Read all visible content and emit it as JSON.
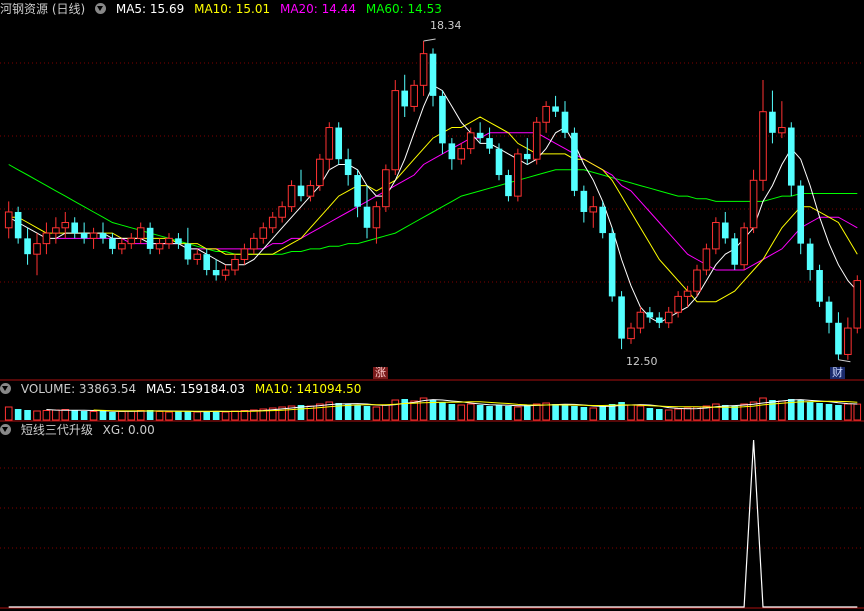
{
  "header": {
    "title": "河钢资源 (日线)",
    "ma5": {
      "label": "MA5: 15.69",
      "color": "#ffffff"
    },
    "ma10": {
      "label": "MA10: 15.01",
      "color": "#ffff00"
    },
    "ma20": {
      "label": "MA20: 14.44",
      "color": "#ff00ff"
    },
    "ma60": {
      "label": "MA60: 14.53",
      "color": "#00ff00"
    }
  },
  "volume_header": {
    "volume": "VOLUME: 33863.54",
    "ma5": "MA5: 159184.03",
    "ma10": "MA10: 141094.50"
  },
  "indicator_header": {
    "name": "短线三代升级",
    "xg": "XG: 0.00"
  },
  "annotations": {
    "high": "18.34",
    "low": "12.50",
    "tag_zhang": "涨",
    "tag_cai": "财"
  },
  "colors": {
    "up": "#ff3232",
    "down": "#54ffff",
    "grid": "#800000",
    "xg": "#ffffff"
  },
  "chart_data": [
    {
      "type": "candlestick",
      "title": "河钢资源 (日线)",
      "ylim": [
        12.2,
        18.7
      ],
      "candles": [
        [
          14.8,
          15.3,
          14.6,
          15.1
        ],
        [
          15.1,
          15.2,
          14.5,
          14.6
        ],
        [
          14.6,
          14.8,
          14.1,
          14.3
        ],
        [
          14.3,
          14.7,
          13.9,
          14.5
        ],
        [
          14.5,
          14.9,
          14.3,
          14.7
        ],
        [
          14.7,
          15.0,
          14.5,
          14.8
        ],
        [
          14.8,
          15.1,
          14.6,
          14.9
        ],
        [
          14.9,
          15.0,
          14.6,
          14.7
        ],
        [
          14.7,
          14.9,
          14.5,
          14.6
        ],
        [
          14.6,
          14.8,
          14.4,
          14.7
        ],
        [
          14.7,
          14.9,
          14.5,
          14.6
        ],
        [
          14.6,
          14.7,
          14.3,
          14.4
        ],
        [
          14.4,
          14.6,
          14.3,
          14.5
        ],
        [
          14.5,
          14.7,
          14.4,
          14.6
        ],
        [
          14.6,
          14.9,
          14.5,
          14.8
        ],
        [
          14.8,
          14.9,
          14.3,
          14.4
        ],
        [
          14.4,
          14.6,
          14.3,
          14.5
        ],
        [
          14.5,
          14.7,
          14.4,
          14.6
        ],
        [
          14.6,
          14.7,
          14.4,
          14.5
        ],
        [
          14.5,
          14.8,
          14.1,
          14.2
        ],
        [
          14.2,
          14.4,
          14.1,
          14.3
        ],
        [
          14.3,
          14.4,
          13.9,
          14.0
        ],
        [
          14.0,
          14.2,
          13.8,
          13.9
        ],
        [
          13.9,
          14.1,
          13.8,
          14.0
        ],
        [
          14.0,
          14.3,
          13.9,
          14.2
        ],
        [
          14.2,
          14.5,
          14.1,
          14.4
        ],
        [
          14.4,
          14.7,
          14.3,
          14.6
        ],
        [
          14.6,
          14.9,
          14.5,
          14.8
        ],
        [
          14.8,
          15.1,
          14.7,
          15.0
        ],
        [
          15.0,
          15.3,
          14.9,
          15.2
        ],
        [
          15.2,
          15.7,
          15.1,
          15.6
        ],
        [
          15.6,
          15.9,
          15.3,
          15.4
        ],
        [
          15.4,
          15.7,
          15.3,
          15.6
        ],
        [
          15.6,
          16.2,
          15.5,
          16.1
        ],
        [
          16.1,
          16.8,
          15.9,
          16.7
        ],
        [
          16.7,
          16.8,
          16.0,
          16.1
        ],
        [
          16.1,
          16.3,
          15.6,
          15.8
        ],
        [
          15.8,
          15.9,
          15.0,
          15.2
        ],
        [
          15.2,
          15.6,
          14.6,
          14.8
        ],
        [
          14.8,
          15.3,
          14.5,
          15.2
        ],
        [
          15.2,
          16.0,
          15.1,
          15.9
        ],
        [
          15.9,
          17.6,
          15.8,
          17.4
        ],
        [
          17.4,
          17.7,
          16.9,
          17.1
        ],
        [
          17.1,
          17.6,
          17.0,
          17.5
        ],
        [
          17.5,
          18.34,
          17.3,
          18.1
        ],
        [
          18.1,
          18.2,
          17.1,
          17.3
        ],
        [
          17.3,
          17.4,
          16.2,
          16.4
        ],
        [
          16.4,
          16.5,
          15.9,
          16.1
        ],
        [
          16.1,
          16.4,
          16.0,
          16.3
        ],
        [
          16.3,
          16.7,
          16.2,
          16.6
        ],
        [
          16.6,
          16.8,
          16.4,
          16.5
        ],
        [
          16.5,
          16.7,
          16.2,
          16.3
        ],
        [
          16.3,
          16.4,
          15.7,
          15.8
        ],
        [
          15.8,
          15.9,
          15.3,
          15.4
        ],
        [
          15.4,
          16.3,
          15.3,
          16.2
        ],
        [
          16.2,
          16.5,
          16.0,
          16.1
        ],
        [
          16.1,
          16.9,
          16.0,
          16.8
        ],
        [
          16.8,
          17.2,
          16.6,
          17.1
        ],
        [
          17.1,
          17.3,
          16.9,
          17.0
        ],
        [
          17.0,
          17.2,
          16.5,
          16.6
        ],
        [
          16.6,
          16.7,
          15.4,
          15.5
        ],
        [
          15.5,
          15.6,
          14.9,
          15.1
        ],
        [
          15.1,
          15.4,
          14.8,
          15.2
        ],
        [
          15.2,
          15.3,
          14.6,
          14.7
        ],
        [
          14.7,
          14.8,
          13.4,
          13.5
        ],
        [
          13.5,
          13.6,
          12.5,
          12.7
        ],
        [
          12.7,
          13.0,
          12.6,
          12.9
        ],
        [
          12.9,
          13.3,
          12.8,
          13.2
        ],
        [
          13.2,
          13.3,
          13.0,
          13.1
        ],
        [
          13.1,
          13.2,
          12.9,
          13.0
        ],
        [
          13.0,
          13.3,
          12.9,
          13.2
        ],
        [
          13.2,
          13.6,
          13.1,
          13.5
        ],
        [
          13.5,
          13.7,
          13.3,
          13.6
        ],
        [
          13.6,
          14.1,
          13.5,
          14.0
        ],
        [
          14.0,
          14.5,
          13.9,
          14.4
        ],
        [
          14.4,
          15.0,
          14.3,
          14.9
        ],
        [
          14.9,
          15.1,
          14.5,
          14.6
        ],
        [
          14.6,
          14.7,
          14.0,
          14.1
        ],
        [
          14.1,
          14.9,
          14.0,
          14.8
        ],
        [
          14.8,
          15.9,
          14.7,
          15.7
        ],
        [
          15.7,
          17.6,
          15.5,
          17.0
        ],
        [
          17.0,
          17.4,
          16.4,
          16.6
        ],
        [
          16.6,
          17.2,
          16.5,
          16.7
        ],
        [
          16.7,
          16.8,
          15.4,
          15.6
        ],
        [
          15.6,
          15.7,
          14.3,
          14.5
        ],
        [
          14.5,
          14.6,
          13.8,
          14.0
        ],
        [
          14.0,
          14.1,
          13.3,
          13.4
        ],
        [
          13.4,
          13.5,
          12.8,
          13.0
        ],
        [
          13.0,
          13.2,
          12.3,
          12.4
        ],
        [
          12.4,
          13.1,
          12.3,
          12.9
        ],
        [
          12.9,
          13.9,
          12.8,
          13.8
        ]
      ],
      "ma5": [
        15.0,
        14.9,
        14.8,
        14.7,
        14.6,
        14.6,
        14.7,
        14.7,
        14.7,
        14.7,
        14.7,
        14.6,
        14.6,
        14.6,
        14.6,
        14.5,
        14.5,
        14.5,
        14.5,
        14.4,
        14.4,
        14.3,
        14.2,
        14.1,
        14.1,
        14.1,
        14.2,
        14.4,
        14.6,
        14.8,
        15.0,
        15.2,
        15.4,
        15.6,
        15.9,
        16.0,
        16.0,
        15.9,
        15.6,
        15.4,
        15.4,
        15.7,
        16.1,
        16.6,
        17.1,
        17.5,
        17.4,
        17.1,
        16.8,
        16.6,
        16.4,
        16.4,
        16.3,
        16.2,
        16.1,
        16.0,
        16.1,
        16.3,
        16.6,
        16.7,
        16.4,
        16.0,
        15.7,
        15.3,
        14.8,
        14.2,
        13.7,
        13.3,
        13.1,
        13.0,
        13.1,
        13.2,
        13.3,
        13.5,
        13.8,
        14.1,
        14.3,
        14.4,
        14.6,
        14.8,
        15.3,
        15.6,
        16.0,
        16.3,
        16.1,
        15.6,
        15.0,
        14.5,
        14.1,
        13.8,
        13.6
      ],
      "ma10": [
        15.0,
        15.0,
        14.9,
        14.8,
        14.7,
        14.7,
        14.7,
        14.7,
        14.7,
        14.7,
        14.7,
        14.7,
        14.6,
        14.6,
        14.6,
        14.6,
        14.6,
        14.6,
        14.5,
        14.5,
        14.5,
        14.4,
        14.4,
        14.3,
        14.3,
        14.3,
        14.3,
        14.3,
        14.3,
        14.4,
        14.5,
        14.6,
        14.8,
        15.0,
        15.2,
        15.4,
        15.5,
        15.6,
        15.6,
        15.5,
        15.6,
        15.7,
        15.9,
        16.1,
        16.3,
        16.5,
        16.6,
        16.7,
        16.7,
        16.8,
        16.9,
        16.8,
        16.7,
        16.6,
        16.4,
        16.3,
        16.2,
        16.2,
        16.2,
        16.2,
        16.1,
        16.1,
        16.0,
        15.9,
        15.7,
        15.4,
        15.1,
        14.8,
        14.5,
        14.2,
        14.0,
        13.8,
        13.6,
        13.4,
        13.4,
        13.4,
        13.5,
        13.6,
        13.8,
        14.0,
        14.2,
        14.5,
        14.8,
        15.0,
        15.2,
        15.2,
        15.1,
        15.0,
        14.9,
        14.6,
        14.3
      ],
      "ma20": [
        null,
        null,
        null,
        null,
        null,
        14.6,
        14.6,
        14.6,
        14.6,
        14.6,
        14.6,
        14.6,
        14.6,
        14.5,
        14.5,
        14.5,
        14.5,
        14.5,
        14.5,
        14.4,
        14.4,
        14.4,
        14.4,
        14.4,
        14.4,
        14.4,
        14.4,
        14.4,
        14.5,
        14.5,
        14.6,
        14.6,
        14.7,
        14.8,
        14.9,
        15.0,
        15.1,
        15.2,
        15.3,
        15.4,
        15.5,
        15.6,
        15.7,
        15.8,
        16.0,
        16.1,
        16.2,
        16.3,
        16.4,
        16.5,
        16.5,
        16.6,
        16.6,
        16.6,
        16.6,
        16.6,
        16.6,
        16.5,
        16.4,
        16.3,
        16.2,
        16.1,
        16.0,
        15.9,
        15.8,
        15.6,
        15.5,
        15.3,
        15.1,
        14.9,
        14.7,
        14.5,
        14.3,
        14.2,
        14.1,
        14.0,
        14.0,
        14.0,
        14.0,
        14.1,
        14.2,
        14.3,
        14.4,
        14.6,
        14.8,
        14.9,
        15.0,
        15.0,
        15.0,
        14.9,
        14.8
      ],
      "ma60": [
        16.0,
        15.9,
        15.8,
        15.7,
        15.6,
        15.5,
        15.4,
        15.3,
        15.2,
        15.1,
        15.0,
        14.9,
        14.85,
        14.8,
        14.75,
        14.7,
        14.65,
        14.6,
        14.55,
        14.5,
        14.45,
        14.4,
        14.35,
        14.35,
        14.3,
        14.3,
        14.3,
        14.3,
        14.3,
        14.3,
        14.35,
        14.35,
        14.4,
        14.4,
        14.45,
        14.45,
        14.5,
        14.5,
        14.55,
        14.6,
        14.65,
        14.7,
        14.8,
        14.9,
        15.0,
        15.1,
        15.2,
        15.3,
        15.4,
        15.45,
        15.5,
        15.55,
        15.6,
        15.65,
        15.7,
        15.75,
        15.8,
        15.85,
        15.9,
        15.9,
        15.9,
        15.9,
        15.85,
        15.8,
        15.75,
        15.7,
        15.65,
        15.6,
        15.55,
        15.5,
        15.45,
        15.4,
        15.4,
        15.35,
        15.35,
        15.3,
        15.3,
        15.3,
        15.3,
        15.3,
        15.3,
        15.35,
        15.4,
        15.4,
        15.45,
        15.45,
        15.45,
        15.45,
        15.45,
        15.45,
        15.45
      ]
    },
    {
      "type": "bar",
      "title": "VOLUME",
      "values": [
        130,
        110,
        100,
        90,
        95,
        100,
        105,
        95,
        90,
        85,
        90,
        80,
        85,
        90,
        95,
        100,
        85,
        80,
        85,
        90,
        80,
        85,
        90,
        80,
        90,
        95,
        100,
        110,
        120,
        130,
        140,
        150,
        140,
        160,
        180,
        170,
        160,
        150,
        140,
        130,
        150,
        200,
        210,
        190,
        220,
        200,
        180,
        160,
        150,
        160,
        150,
        140,
        150,
        140,
        130,
        150,
        160,
        170,
        160,
        150,
        140,
        130,
        120,
        140,
        160,
        180,
        150,
        140,
        120,
        110,
        100,
        110,
        120,
        130,
        140,
        160,
        150,
        140,
        160,
        180,
        220,
        200,
        190,
        210,
        200,
        180,
        170,
        160,
        150,
        160,
        159
      ],
      "ma5": 159184.03,
      "ma10": 141094.5
    },
    {
      "type": "line",
      "title": "短线三代升级",
      "series": [
        {
          "name": "XG",
          "values": [
            0,
            0,
            0,
            0,
            0,
            0,
            0,
            0,
            0,
            0,
            0,
            0,
            0,
            0,
            0,
            0,
            0,
            0,
            0,
            0,
            0,
            0,
            0,
            0,
            0,
            0,
            0,
            0,
            0,
            0,
            0,
            0,
            0,
            0,
            0,
            0,
            0,
            0,
            0,
            0,
            0,
            0,
            0,
            0,
            0,
            0,
            0,
            0,
            0,
            0,
            0,
            0,
            0,
            0,
            0,
            0,
            0,
            0,
            0,
            0,
            0,
            0,
            0,
            0,
            0,
            0,
            0,
            0,
            0,
            0,
            0,
            0,
            0,
            0,
            0,
            0,
            0,
            0,
            0,
            1,
            0,
            0,
            0,
            0,
            0,
            0,
            0,
            0,
            0,
            0,
            0
          ]
        }
      ],
      "ylim": [
        0,
        1
      ]
    }
  ]
}
